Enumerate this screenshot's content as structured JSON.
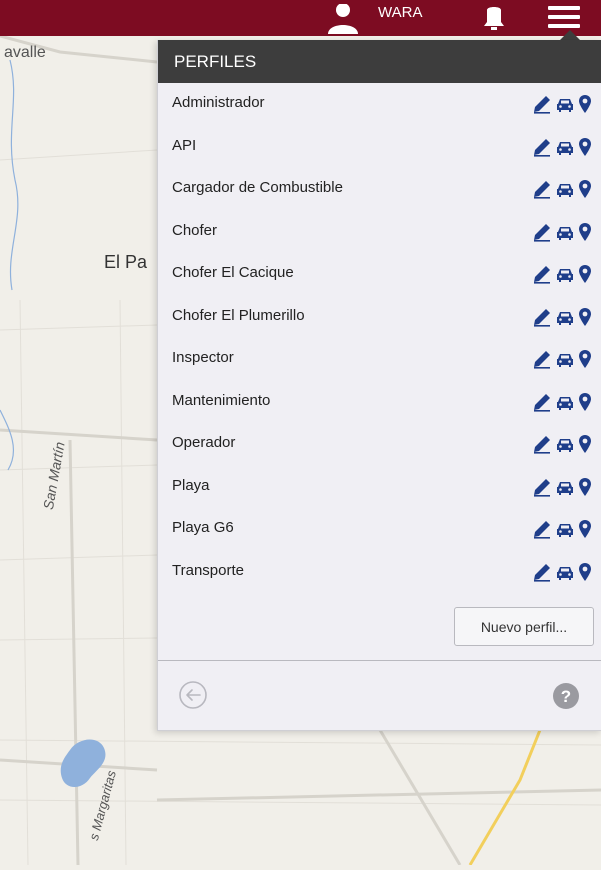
{
  "map": {
    "label_top": "avalle",
    "label_town": "El Pa",
    "label_street_1": "San Martín",
    "label_street_2": "s Margaritas"
  },
  "topbar": {
    "user_name": "WARA",
    "user_icon": "user-icon",
    "bell_icon": "bell-icon",
    "menu_icon": "hamburger-menu-icon",
    "bar_color": "#7d0c22"
  },
  "panel": {
    "title": "PERFILES",
    "profiles": [
      {
        "label": "Administrador"
      },
      {
        "label": "API"
      },
      {
        "label": "Cargador de Combustible"
      },
      {
        "label": "Chofer"
      },
      {
        "label": "Chofer El Cacique"
      },
      {
        "label": "Chofer El Plumerillo"
      },
      {
        "label": "Inspector"
      },
      {
        "label": "Mantenimiento"
      },
      {
        "label": "Operador"
      },
      {
        "label": "Playa"
      },
      {
        "label": "Playa G6"
      },
      {
        "label": "Transporte"
      }
    ],
    "row_action_icons": [
      "pencil-icon",
      "car-icon",
      "map-pin-icon"
    ],
    "new_profile_label": "Nuevo perfil...",
    "back_icon": "back-arrow-icon",
    "help_icon": "help-icon",
    "icon_color": "#1f3e8a"
  }
}
